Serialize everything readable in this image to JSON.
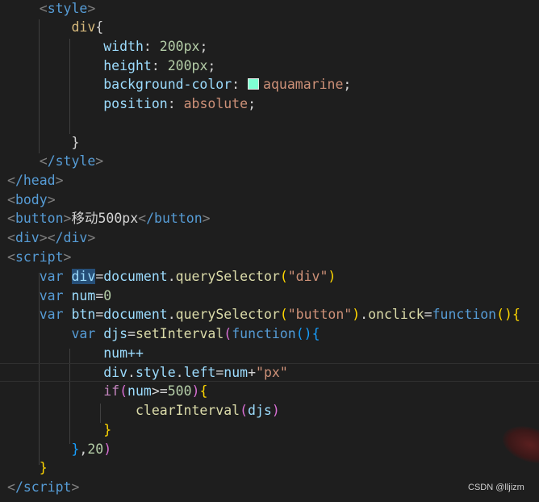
{
  "colors": {
    "background": "#1e1e1e",
    "tag": "#569cd6",
    "selector": "#d7ba7d",
    "property": "#9cdcfe",
    "number": "#b5cea8",
    "string": "#ce9178",
    "function": "#dcdcaa",
    "keyword": "#569cd6",
    "control": "#c586c0",
    "swatch": "#7fffd4"
  },
  "code": {
    "style_open": "style",
    "css_selector": "div",
    "width_prop": "width",
    "width_val": "200px",
    "height_prop": "height",
    "height_val": "200px",
    "bg_prop": "background-color",
    "bg_val": "aquamarine",
    "pos_prop": "position",
    "pos_val": "absolute",
    "style_close": "/style",
    "head_close": "/head",
    "body_open": "body",
    "button_tag": "button",
    "button_text": "移动500px",
    "button_close": "/button",
    "div_tag": "div",
    "div_close": "/div",
    "script_open": "script",
    "script_close": "/script",
    "var_kw": "var",
    "div_var": "div",
    "document": "document",
    "qs": "querySelector",
    "str_div": "\"div\"",
    "num_var": "num",
    "num_init": "0",
    "btn_var": "btn",
    "str_button": "\"button\"",
    "onclick": "onclick",
    "function_kw": "function",
    "djs_var": "djs",
    "setInterval": "setInterval",
    "num_inc": "num++",
    "style_kw": "style",
    "left_kw": "left",
    "str_px": "\"px\"",
    "if_kw": "if",
    "limit": "500",
    "clearInterval": "clearInterval",
    "interval": "20"
  },
  "watermark": "CSDN @lljizm"
}
